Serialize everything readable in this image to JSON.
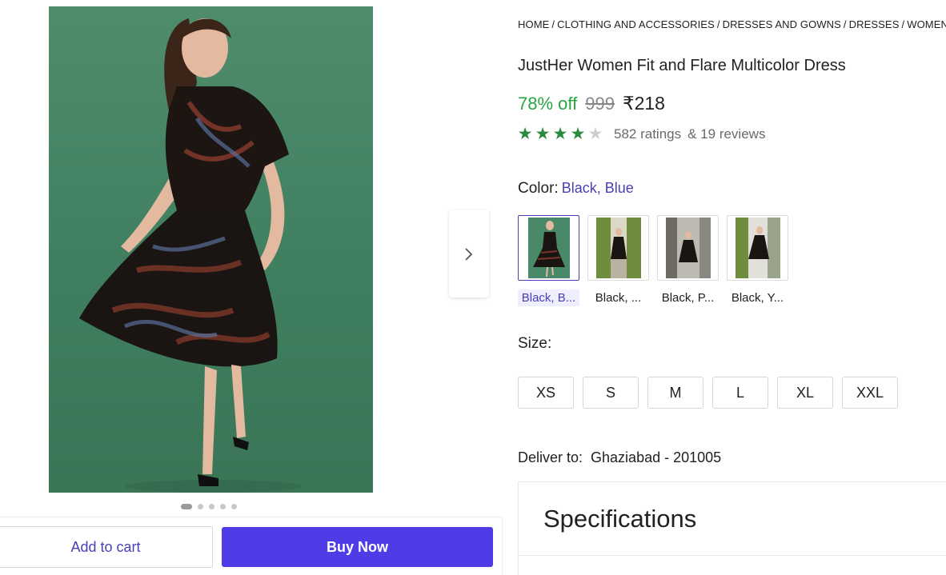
{
  "breadcrumb": [
    "HOME",
    "CLOTHING AND ACCESSORIES",
    "DRESSES AND GOWNS",
    "DRESSES",
    "WOMEN'S DRESSES"
  ],
  "product": {
    "title": "JustHer Women Fit and Flare Multicolor Dress",
    "discount": "78% off",
    "mrp": "999",
    "price": "₹218",
    "rating_stars": 4,
    "rating_max": 5,
    "ratings_text": "582 ratings",
    "reviews_text": "& 19 reviews"
  },
  "gallery": {
    "total_images": 5,
    "active_index": 0
  },
  "color": {
    "label": "Color:",
    "selected": "Black, Blue",
    "options": [
      {
        "caption": "Black, B...",
        "selected": true
      },
      {
        "caption": "Black, ...",
        "selected": false
      },
      {
        "caption": "Black, P...",
        "selected": false
      },
      {
        "caption": "Black, Y...",
        "selected": false
      }
    ]
  },
  "size": {
    "label": "Size:",
    "options": [
      "XS",
      "S",
      "M",
      "L",
      "XL",
      "XXL"
    ]
  },
  "delivery": {
    "label": "Deliver to:",
    "location": "Ghaziabad - 201005"
  },
  "specifications": {
    "title": "Specifications"
  },
  "actions": {
    "add_to_cart": "Add to cart",
    "buy_now": "Buy Now"
  },
  "colors": {
    "accent": "#4f3ce6",
    "link": "#4a3fb6",
    "discount": "#26a541",
    "star": "#2b8a3e",
    "photo_background": "#4a886a"
  }
}
